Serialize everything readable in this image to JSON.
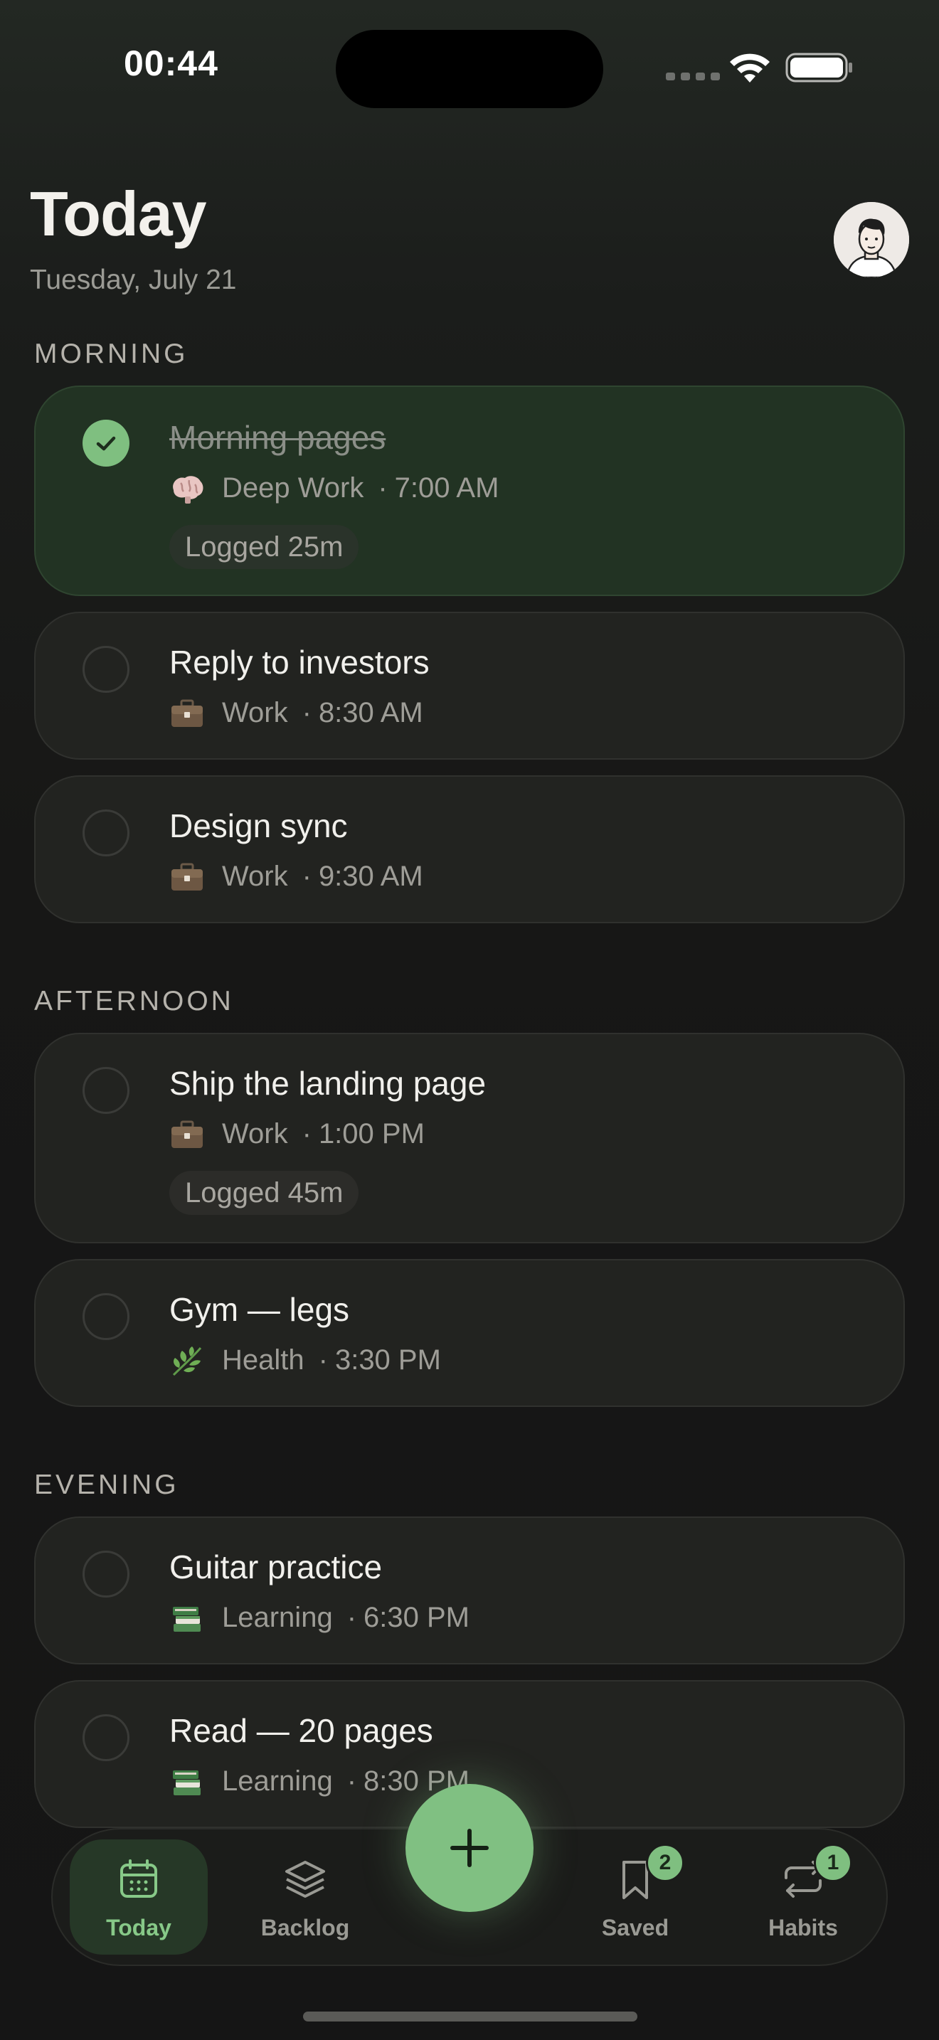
{
  "status_bar": {
    "time": "00:44"
  },
  "header": {
    "title": "Today",
    "date": "Tuesday, July 21"
  },
  "sections": [
    {
      "label": "MORNING"
    },
    {
      "label": "AFTERNOON"
    },
    {
      "label": "EVENING"
    }
  ],
  "tasks": [
    {
      "title": "Morning pages",
      "icon": "brain-icon",
      "category": "Deep Work",
      "time": "7:00 AM",
      "done": true,
      "logged": "Logged 25m"
    },
    {
      "title": "Reply to investors",
      "icon": "briefcase-icon",
      "category": "Work",
      "time": "8:30 AM",
      "done": false
    },
    {
      "title": "Design sync",
      "icon": "briefcase-icon",
      "category": "Work",
      "time": "9:30 AM",
      "done": false
    },
    {
      "title": "Ship the landing page",
      "icon": "briefcase-icon",
      "category": "Work",
      "time": "1:00 PM",
      "done": false,
      "logged": "Logged 45m"
    },
    {
      "title": "Gym — legs",
      "icon": "herb-icon",
      "category": "Health",
      "time": "3:30 PM",
      "done": false
    },
    {
      "title": "Guitar practice",
      "icon": "books-icon",
      "category": "Learning",
      "time": "6:30 PM",
      "done": false
    },
    {
      "title": "Read — 20 pages",
      "icon": "books-icon",
      "category": "Learning",
      "time": "8:30 PM",
      "done": false
    }
  ],
  "meta_separator": "·",
  "nav": {
    "today": "Today",
    "backlog": "Backlog",
    "saved": "Saved",
    "saved_badge": "2",
    "habits": "Habits",
    "habits_badge": "1"
  },
  "colors": {
    "accent": "#80c082",
    "background": "#171716",
    "card": "#222320",
    "card_done": "#223323"
  }
}
